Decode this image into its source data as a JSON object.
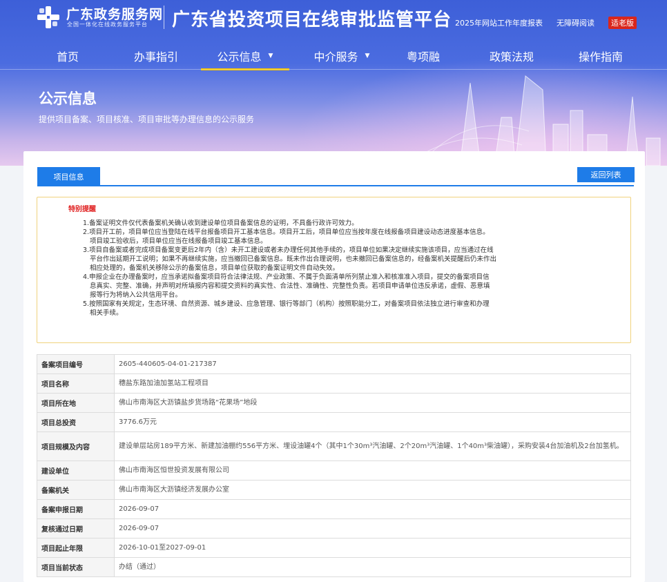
{
  "header": {
    "logo_name": "广东政务服务网",
    "logo_sub": "全国一体化在线政务服务平台",
    "site_title": "广东省投资项目在线审批监管平台",
    "links": [
      "2025年网站工作年度报表",
      "无障碍阅读",
      "适老版"
    ]
  },
  "nav": {
    "items": [
      {
        "label": "首页"
      },
      {
        "label": "办事指引"
      },
      {
        "label": "公示信息",
        "active": true,
        "dropdown": true
      },
      {
        "label": "中介服务",
        "dropdown": true
      },
      {
        "label": "粤项融"
      },
      {
        "label": "政策法规"
      },
      {
        "label": "操作指南"
      }
    ]
  },
  "banner": {
    "title": "公示信息",
    "desc": "提供项目备案、项目核准、项目审批等办理信息的公示服务"
  },
  "panel": {
    "tab_label": "项目信息",
    "back_label": "返回列表"
  },
  "notice": {
    "title": "特别提醒",
    "lines": [
      "1.备案证明文件仅代表备案机关确认收到建设单位项目备案信息的证明，不具备行政许可效力。",
      "2.项目开工前，项目单位应当登陆在线平台报备项目开工基本信息。项目开工后，项目单位应当按年度在线报备项目建设动态进度基本信息。",
      "项目竣工验收后，项目单位应当在线报备项目竣工基本信息。",
      "3.项目自备案或者完成项目备案变更后2年内（含）未开工建设或者未办理任何其他手续的，项目单位如果决定继续实施该项目，应当通过在线",
      "平台作出延期开工说明；如果不再继续实施，应当撤回已备案信息。既未作出合理说明，也未撤回已备案信息的，经备案机关提醒后仍未作出",
      "相应处理的，备案机关移除公示的备案信息，项目单位获取的备案证明文件自动失效。",
      "4.申报企业在办理备案时，应当承诺拟备案项目符合法律法规、产业政策、不属于负面清单所列禁止准入和核准准入项目，提交的备案项目信",
      "息真实、完整、准确，并声明对所填报内容和提交资料的真实性、合法性、准确性、完整性负责。若项目申请单位违反承诺，虚假、恶意填",
      "报等行为将纳入公共信用平台。",
      "5.按照国家有关规定，生态环境、自然资源、城乡建设、应急管理、银行等部门（机构）按照职能分工，对备案项目依法独立进行审查和办理",
      "相关手续。"
    ]
  },
  "table": {
    "rows": [
      {
        "label": "备案项目编号",
        "value": "2605-440605-04-01-217387"
      },
      {
        "label": "项目名称",
        "value": "穗盐东路加油加氢站工程项目"
      },
      {
        "label": "项目所在地",
        "value": "佛山市南海区大沥镇盐步货场路“花果场”地段"
      },
      {
        "label": "项目总投资",
        "value": "3776.6万元"
      },
      {
        "label": "项目规模及内容",
        "value": "建设单层站房189平方米、新建加油棚约556平方米、埋设油罐4个（其中1个30m³汽油罐、2个20m³汽油罐、1个40m³柴油罐），采购安装4台加油机及2台加氢机。"
      },
      {
        "label": "建设单位",
        "value": "佛山市南海区恒世投资发展有限公司"
      },
      {
        "label": "备案机关",
        "value": "佛山市南海区大沥镇经济发展办公室"
      },
      {
        "label": "备案申报日期",
        "value": "2026-09-07"
      },
      {
        "label": "复核通过日期",
        "value": "2026-09-07"
      },
      {
        "label": "项目起止年限",
        "value": "2026-10-01至2027-09-01"
      },
      {
        "label": "项目当前状态",
        "value": "办结（通过）"
      }
    ]
  },
  "colors": {
    "primary": "#1e7ce8",
    "nav_active_underline": "#f6c200",
    "alert_title": "#e02020",
    "notice_border": "#f0d27c"
  }
}
